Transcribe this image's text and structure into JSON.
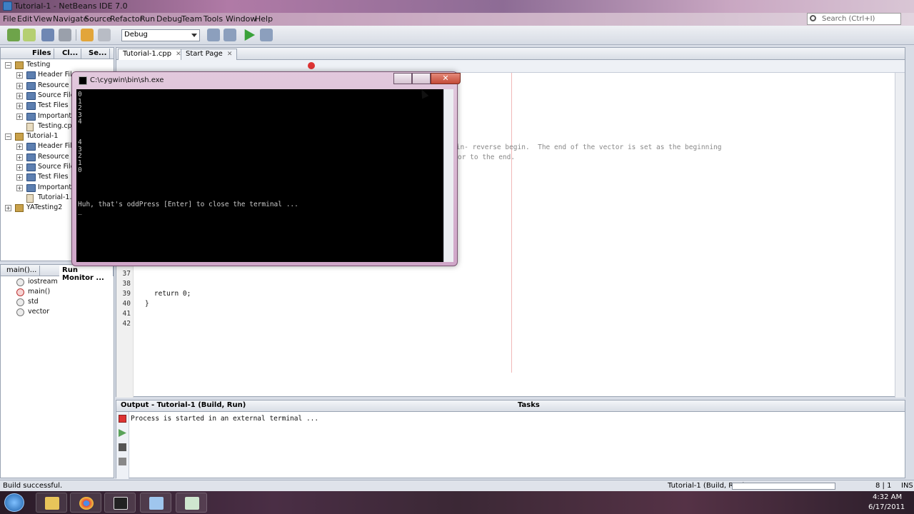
{
  "window": {
    "title": "Tutorial-1 - NetBeans IDE 7.0"
  },
  "menu": {
    "items": [
      "File",
      "Edit",
      "View",
      "Navigate",
      "Source",
      "Refactor",
      "Run",
      "Debug",
      "Team",
      "Tools",
      "Window",
      "Help"
    ],
    "search_placeholder": "Search (Ctrl+I)"
  },
  "toolbar": {
    "config_value": "Debug"
  },
  "projects_panel": {
    "tabs": [
      "Files",
      "Cl...",
      "Se..."
    ],
    "tree": [
      {
        "label": "Testing",
        "kind": "project",
        "level": 0,
        "toggle": "−"
      },
      {
        "label": "Header Files",
        "kind": "folder",
        "level": 1,
        "toggle": "+"
      },
      {
        "label": "Resource Files",
        "kind": "folder",
        "level": 1,
        "toggle": "+"
      },
      {
        "label": "Source Files",
        "kind": "folder",
        "level": 1,
        "toggle": "+"
      },
      {
        "label": "Test Files",
        "kind": "folder",
        "level": 1,
        "toggle": "+"
      },
      {
        "label": "Important Files",
        "kind": "folder",
        "level": 1,
        "toggle": "+"
      },
      {
        "label": "Testing.cpp",
        "kind": "file",
        "level": 1,
        "toggle": ""
      },
      {
        "label": "Tutorial-1",
        "kind": "project",
        "level": 0,
        "toggle": "−"
      },
      {
        "label": "Header Files",
        "kind": "folder",
        "level": 1,
        "toggle": "+"
      },
      {
        "label": "Resource Files",
        "kind": "folder",
        "level": 1,
        "toggle": "+"
      },
      {
        "label": "Source Files",
        "kind": "folder",
        "level": 1,
        "toggle": "+"
      },
      {
        "label": "Test Files",
        "kind": "folder",
        "level": 1,
        "toggle": "+"
      },
      {
        "label": "Important Files",
        "kind": "folder",
        "level": 1,
        "toggle": "+"
      },
      {
        "label": "Tutorial-1.cpp",
        "kind": "file",
        "level": 1,
        "toggle": ""
      },
      {
        "label": "YATesting2",
        "kind": "project",
        "level": 0,
        "toggle": "+"
      }
    ]
  },
  "navigator_panel": {
    "tabs": [
      "main()...",
      "Run Monitor ..."
    ],
    "items": [
      "iostream",
      "main()",
      "std",
      "vector"
    ]
  },
  "editor": {
    "tabs": [
      "Tutorial-1.cpp",
      "Start Page"
    ],
    "visible_comment_line1": "gin- reverse begin.  The end of the vector is set as the beginning",
    "visible_comment_line2": "or to the end.",
    "lines": [
      {
        "no": "37",
        "code": ""
      },
      {
        "no": "38",
        "code": ""
      },
      {
        "no": "39",
        "code": "    return 0;"
      },
      {
        "no": "40",
        "code": "}"
      },
      {
        "no": "41",
        "code": ""
      },
      {
        "no": "42",
        "code": ""
      }
    ]
  },
  "output": {
    "title": "Output - Tutorial-1 (Build, Run)",
    "tasks_tab": "Tasks",
    "text": "Process is started in an external terminal ..."
  },
  "terminal": {
    "title": "C:\\cygwin\\bin\\sh.exe",
    "lines": [
      "0",
      "1",
      "2",
      "3",
      "4",
      "",
      "",
      "4",
      "3",
      "2",
      "1",
      "0",
      "",
      "",
      "",
      "",
      "Huh, that's oddPress [Enter] to close the terminal ...",
      "_"
    ]
  },
  "statusbar": {
    "message": "Build successful.",
    "task": "Tutorial-1 (Build, Run)",
    "position": "8 | 1",
    "mode": "INS"
  },
  "taskbar": {
    "time": "4:32 AM",
    "date": "6/17/2011"
  }
}
